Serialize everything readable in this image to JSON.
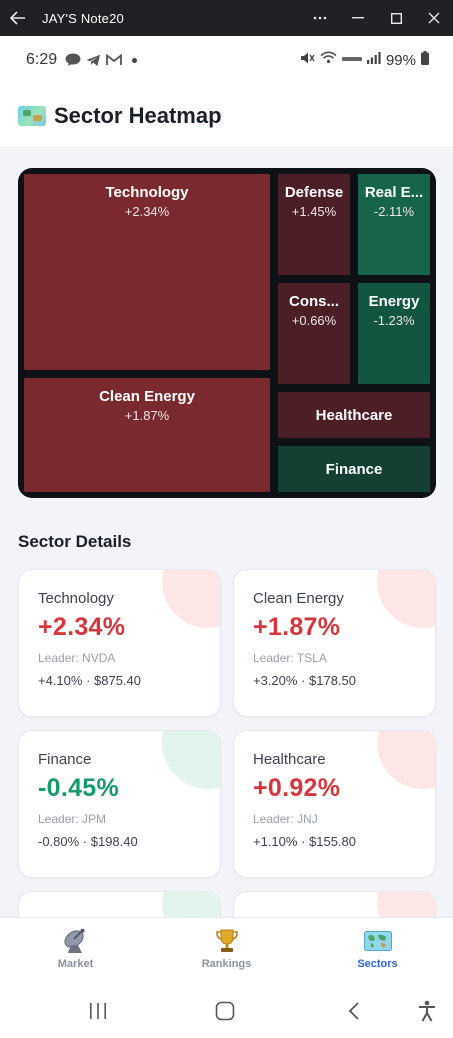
{
  "window": {
    "title": "JAY'S Note20"
  },
  "status_bar": {
    "time": "6:29",
    "battery": "99%"
  },
  "header": {
    "title": "Sector Heatmap",
    "icon": "world-map-icon"
  },
  "heatmap": {
    "tiles": [
      {
        "name": "Technology",
        "change": "+2.34%"
      },
      {
        "name": "Defense",
        "change": "+1.45%"
      },
      {
        "name": "Real E...",
        "change": "-2.11%"
      },
      {
        "name": "Cons...",
        "change": "+0.66%"
      },
      {
        "name": "Energy",
        "change": "-1.23%"
      },
      {
        "name": "Clean Energy",
        "change": "+1.87%"
      },
      {
        "name": "Healthcare",
        "change": ""
      },
      {
        "name": "Finance",
        "change": ""
      }
    ],
    "colors": {
      "positive": "#7a2a2f",
      "negative": "#16644a",
      "background": "#0e1116"
    }
  },
  "details": {
    "title": "Sector Details",
    "cards": [
      {
        "name": "Technology",
        "change": "+2.34%",
        "leader": "Leader: NVDA",
        "meta": "+4.10% · $875.40"
      },
      {
        "name": "Clean Energy",
        "change": "+1.87%",
        "leader": "Leader: TSLA",
        "meta": "+3.20% · $178.50"
      },
      {
        "name": "Finance",
        "change": "-0.45%",
        "leader": "Leader: JPM",
        "meta": "-0.80% · $198.40"
      },
      {
        "name": "Healthcare",
        "change": "+0.92%",
        "leader": "Leader: JNJ",
        "meta": "+1.10% · $155.80"
      }
    ],
    "colors": {
      "up": "#d6363c",
      "down": "#159a6b"
    }
  },
  "bottom_nav": {
    "items": [
      {
        "label": "Market",
        "icon": "satellite-dish-icon"
      },
      {
        "label": "Rankings",
        "icon": "trophy-icon"
      },
      {
        "label": "Sectors",
        "icon": "world-map-icon",
        "active": true
      }
    ],
    "active_color": "#2f63e0"
  }
}
